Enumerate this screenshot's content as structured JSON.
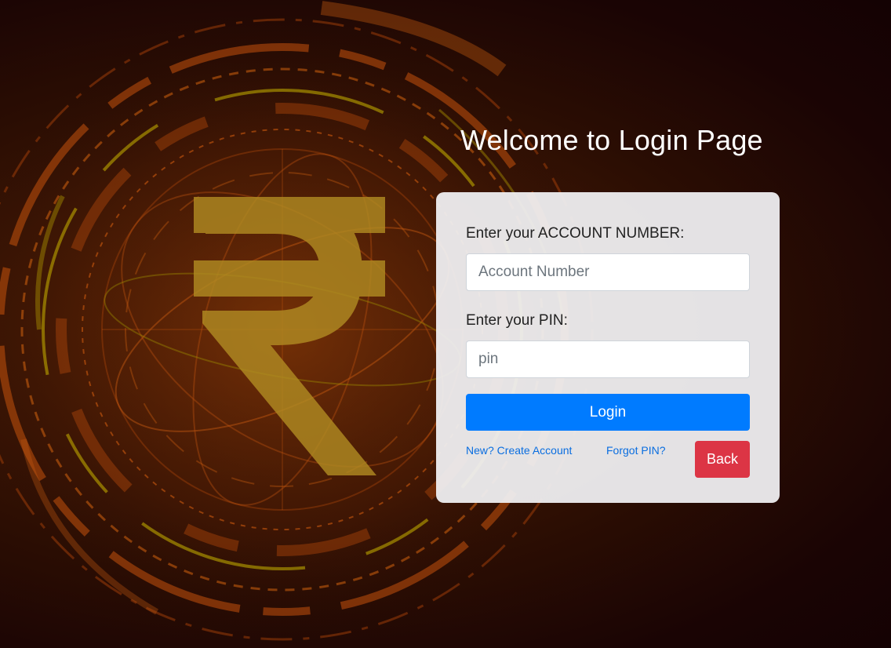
{
  "page": {
    "title": "Welcome to Login Page",
    "background_icon": "rupee-icon"
  },
  "form": {
    "account_label": "Enter your ACCOUNT NUMBER:",
    "account_placeholder": "Account Number",
    "account_value": "",
    "pin_label": "Enter your PIN:",
    "pin_placeholder": "pin",
    "pin_value": "",
    "login_label": "Login",
    "create_account_link": "New? Create Account",
    "forgot_pin_link": "Forgot PIN?",
    "back_label": "Back"
  },
  "colors": {
    "primary": "#007bff",
    "danger": "#dc3545",
    "link": "#0a6ee0",
    "card": "#f0f0f2",
    "background": "#2a0d03",
    "accent_gold": "#b5902a"
  }
}
